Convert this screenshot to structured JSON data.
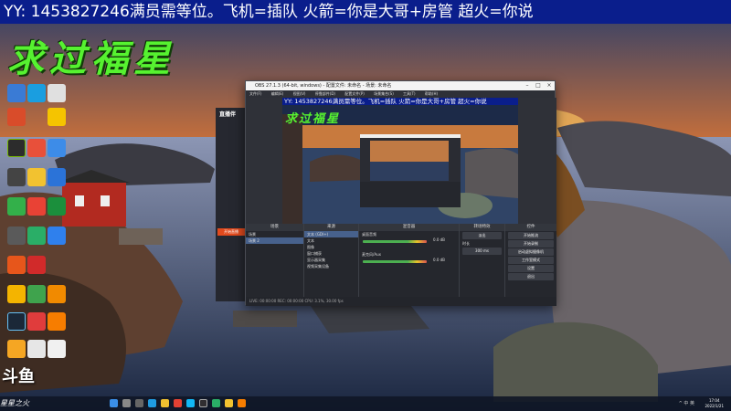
{
  "banner": {
    "text": "YY: 1453827246满员需等位。飞机=插队 火箭=你是大哥+房管 超火=你说"
  },
  "wish_title": "求过福星",
  "watermark": "斗鱼",
  "star_tag": "星星之火",
  "obs": {
    "title": "OBS 27.1.3 (64-bit, windows) - 配置文件: 未命名 - 场景: 未命名",
    "menu": [
      "文件(F)",
      "编辑(E)",
      "视图(V)",
      "停靠部件(D)",
      "配置文件(P)",
      "场景集合(S)",
      "工具(T)",
      "帮助(H)"
    ],
    "preview_banner": "YY: 1453827246满员需等位。飞机=插队 火箭=你是大哥+房管 超火=你说",
    "preview_wish": "求过福星",
    "docks": {
      "scenes_header": "场景",
      "scenes": [
        "场景",
        "场景 2"
      ],
      "sources_header": "来源",
      "sources": [
        "文本 (GDI+)",
        "文本",
        "图像",
        "窗口捕获",
        "显示器采集",
        "视频采集设备"
      ],
      "mixer_header": "混音器",
      "mixer_channels": [
        {
          "name": "桌面音频",
          "level": "0.0 dB"
        },
        {
          "name": "麦克风/Aux",
          "level": "0.0 dB"
        }
      ],
      "transitions_header": "转场特效",
      "transition_type": "淡出",
      "transition_duration_label": "时长",
      "transition_duration": "300 ms",
      "controls_header": "控件",
      "controls": [
        "开始推流",
        "开始录制",
        "启动虚拟摄像机",
        "工作室模式",
        "设置",
        "退出"
      ]
    },
    "status": "LIVE: 00:00:00   REC: 00:00:00   CPU: 3.1%, 30.00 fps"
  },
  "helper": {
    "logo": "直播伴",
    "button": "开始直播"
  },
  "taskbar": {
    "tray": "^ 中 英",
    "time": "17:04",
    "date": "2022/1/21"
  },
  "colors": {
    "banner_bg": "#0a1e8c",
    "wish_green": "#56f230",
    "obs_bg": "#2a2c33",
    "sky_orange": "#f0a040"
  }
}
